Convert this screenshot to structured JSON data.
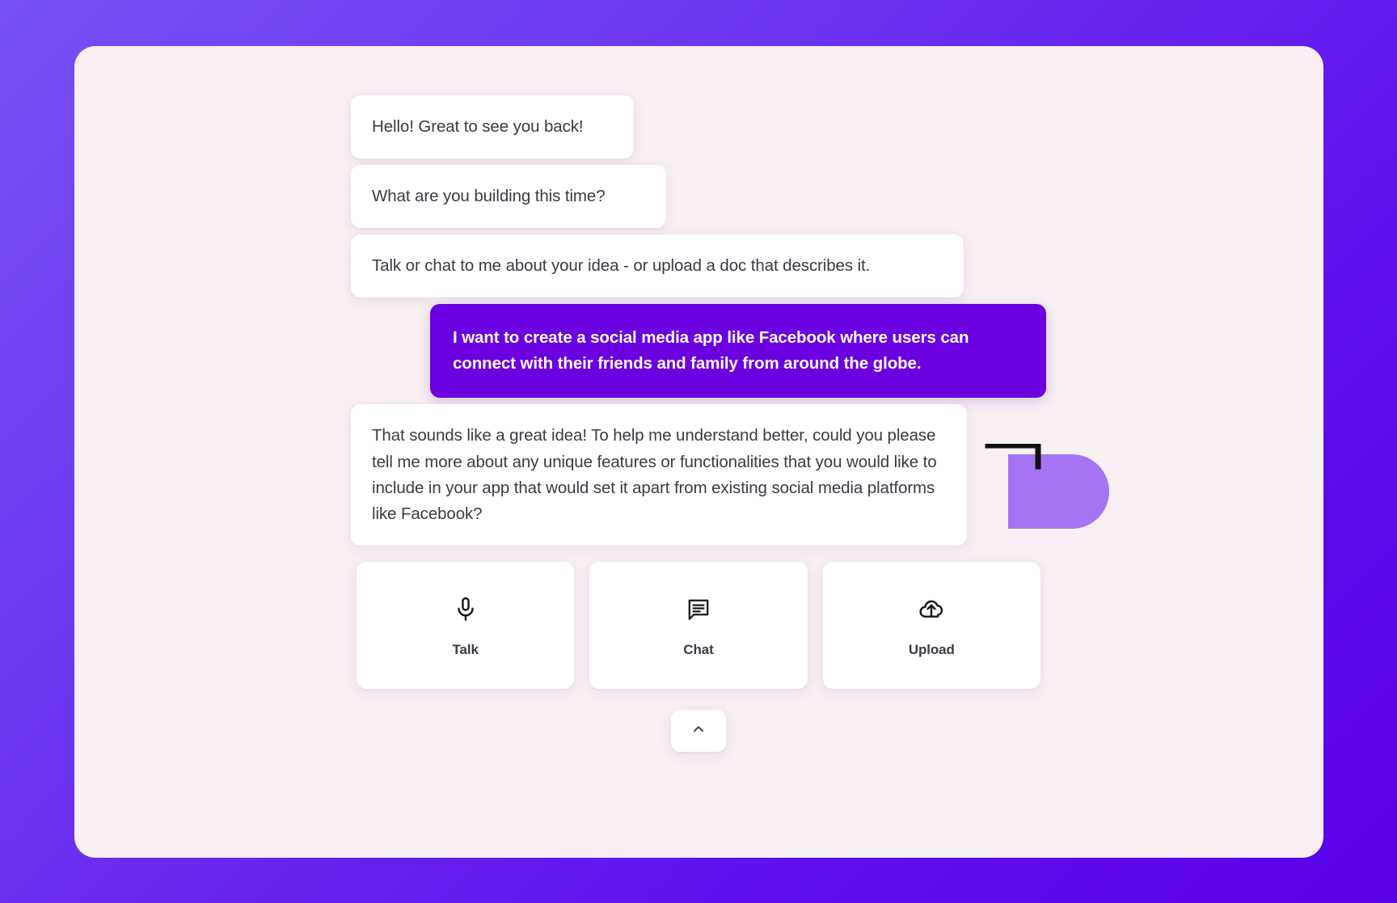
{
  "theme": {
    "bg_gradient_from": "#7550F5",
    "bg_gradient_to": "#5A00E8",
    "card_bg": "#F7EFF3",
    "assistant_bubble_bg": "#FFFFFF",
    "assistant_text": "#3A3B44",
    "user_bubble_bg": "#6B00E0",
    "user_text": "#FFFFFF",
    "accent": "#6B00E0",
    "deco_blob": "#A375F5"
  },
  "conversation": {
    "messages": [
      {
        "role": "assistant",
        "text": "Hello! Great to see you back!"
      },
      {
        "role": "assistant",
        "text": "What are you building this time?"
      },
      {
        "role": "assistant",
        "text": "Talk or chat to me about your idea - or upload a doc that describes it."
      },
      {
        "role": "user",
        "text": "I want to create a social media app like Facebook where users can connect with their friends and family from around the globe."
      },
      {
        "role": "assistant",
        "text": "That sounds like a great idea! To help me understand better, could you please tell me more about any unique features or functionalities that you would like to include in your app that would set it apart from existing social media platforms like Facebook?"
      }
    ]
  },
  "actions": [
    {
      "id": "talk",
      "label": "Talk",
      "icon": "microphone-icon"
    },
    {
      "id": "chat",
      "label": "Chat",
      "icon": "chat-bubble-icon"
    },
    {
      "id": "upload",
      "label": "Upload",
      "icon": "cloud-upload-icon"
    }
  ],
  "expander": {
    "icon": "chevron-up-icon"
  }
}
